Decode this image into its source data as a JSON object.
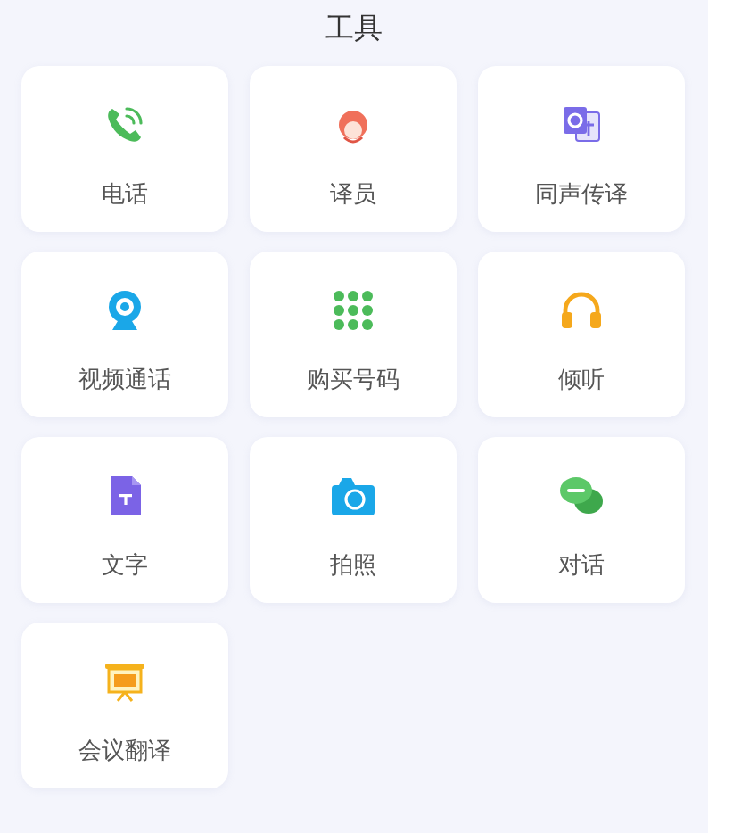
{
  "title": "工具",
  "tools": [
    {
      "label": "电话",
      "kind": "phone"
    },
    {
      "label": "译员",
      "kind": "interpreter"
    },
    {
      "label": "同声传译",
      "kind": "translate"
    },
    {
      "label": "视频通话",
      "kind": "webcam"
    },
    {
      "label": "购买号码",
      "kind": "keypad"
    },
    {
      "label": "倾听",
      "kind": "headphones"
    },
    {
      "label": "文字",
      "kind": "document"
    },
    {
      "label": "拍照",
      "kind": "camera"
    },
    {
      "label": "对话",
      "kind": "chat"
    },
    {
      "label": "会议翻译",
      "kind": "presentation"
    }
  ]
}
